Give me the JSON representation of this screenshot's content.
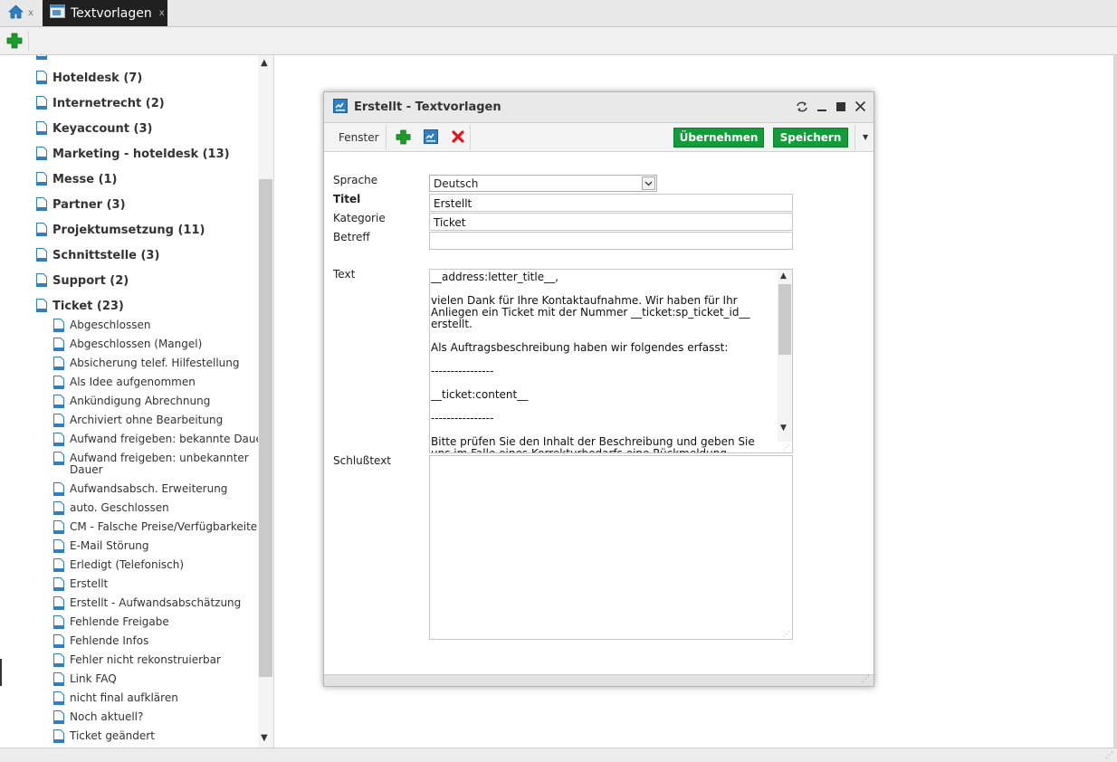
{
  "tabs": {
    "home_close": "x",
    "main_label": "Textvorlagen",
    "main_close": "x"
  },
  "tree": {
    "categories": [
      {
        "label": "Hoteldesk (7)"
      },
      {
        "label": "Internetrecht (2)"
      },
      {
        "label": "Keyaccount (3)"
      },
      {
        "label": "Marketing - hoteldesk (13)"
      },
      {
        "label": "Messe (1)"
      },
      {
        "label": "Partner (3)"
      },
      {
        "label": "Projektumsetzung (11)"
      },
      {
        "label": "Schnittstelle (3)"
      },
      {
        "label": "Support (2)"
      },
      {
        "label": "Ticket (23)"
      }
    ],
    "ticket_items": [
      {
        "label": "Abgeschlossen"
      },
      {
        "label": "Abgeschlossen (Mangel)"
      },
      {
        "label": "Absicherung telef. Hilfestellung"
      },
      {
        "label": "Als Idee aufgenommen"
      },
      {
        "label": "Ankündigung Abrechnung"
      },
      {
        "label": "Archiviert ohne Bearbeitung"
      },
      {
        "label": "Aufwand freigeben: bekannte Dauer"
      },
      {
        "label": "Aufwand freigeben: unbekannter Dauer"
      },
      {
        "label": "Aufwandsabsch. Erweiterung"
      },
      {
        "label": "auto. Geschlossen"
      },
      {
        "label": "CM - Falsche Preise/Verfügbarkeiten"
      },
      {
        "label": "E-Mail Störung"
      },
      {
        "label": "Erledigt (Telefonisch)"
      },
      {
        "label": "Erstellt"
      },
      {
        "label": "Erstellt - Aufwandsabschätzung"
      },
      {
        "label": "Fehlende Freigabe"
      },
      {
        "label": "Fehlende Infos"
      },
      {
        "label": "Fehler nicht rekonstruierbar"
      },
      {
        "label": "Link FAQ"
      },
      {
        "label": "nicht final aufklären"
      },
      {
        "label": "Noch aktuell?"
      },
      {
        "label": "Ticket geändert"
      }
    ]
  },
  "dialog": {
    "title": "Erstellt - Textvorlagen",
    "toolbar": {
      "fenster_label": "Fenster",
      "apply_label": "Übernehmen",
      "save_label": "Speichern"
    },
    "form": {
      "sprache_label": "Sprache",
      "sprache_value": "Deutsch",
      "titel_label": "Titel",
      "titel_value": "Erstellt",
      "kategorie_label": "Kategorie",
      "kategorie_value": "Ticket",
      "betreff_label": "Betreff",
      "betreff_value": "",
      "text_label": "Text",
      "text_value": "__address:letter_title__,\n\nvielen Dank für Ihre Kontaktaufnahme. Wir haben für Ihr Anliegen ein Ticket mit der Nummer __ticket:sp_ticket_id__ erstellt.\n\nAls Auftragsbeschreibung haben wir folgendes erfasst:\n\n----------------\n\n__ticket:content__\n\n----------------\n\nBitte prüfen Sie den Inhalt der Beschreibung und geben Sie uns im Falle eines Korrekturbedarfs eine Rückmeldung.",
      "schluss_label": "Schlußtext",
      "schluss_value": ""
    }
  },
  "colors": {
    "accent_green": "#139c3a",
    "add_green": "#1a9c2a",
    "delete_red": "#e01818",
    "icon_blue": "#2f7fc1",
    "tab_active_bg": "#202020"
  },
  "icons": [
    "home-icon",
    "textvorlagen-tab-icon",
    "add-icon",
    "document-icon",
    "template-icon",
    "delete-icon",
    "refresh-icon",
    "minimize-icon",
    "maximize-icon",
    "close-icon",
    "chevron-down-icon"
  ]
}
